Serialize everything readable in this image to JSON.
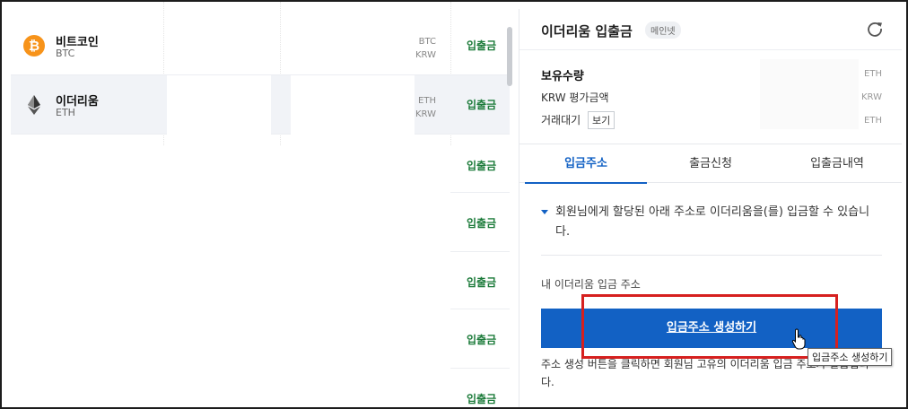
{
  "coins": [
    {
      "name": "비트코인",
      "symbol": "BTC",
      "cur1": "BTC",
      "cur2": "KRW",
      "action": "입출금"
    },
    {
      "name": "이더리움",
      "symbol": "ETH",
      "cur1": "ETH",
      "cur2": "KRW",
      "action": "입출금"
    }
  ],
  "extra_actions": [
    "입출금",
    "입출금",
    "입출금",
    "입출금",
    "입출금",
    "입출금"
  ],
  "panel": {
    "title": "이더리움 입출금",
    "network_badge": "메인넷",
    "holdings": {
      "qty_label": "보유수량",
      "qty_unit": "ETH",
      "krw_label": "KRW 평가금액",
      "krw_unit": "KRW",
      "pending_label": "거래대기",
      "view_label": "보기",
      "pending_unit": "ETH"
    },
    "tabs": [
      "입금주소",
      "출금신청",
      "입출금내역"
    ],
    "notice": "회원님에게 할당된 아래 주소로 이더리움을(를) 입금할 수 있습니다.",
    "address_label": "내 이더리움 입금 주소",
    "generate_button": "입금주소 생성하기",
    "footer_note": "주소 생성 버튼을 클릭하면 회원님 고유의 이더리움 입금 주소가 발급됩니다."
  },
  "tooltip": "입금주소 생성하기",
  "colors": {
    "accent": "#1261c4",
    "action_green": "#1c7b3a",
    "btc_orange": "#f7931a",
    "highlight_red": "#d6201f"
  }
}
